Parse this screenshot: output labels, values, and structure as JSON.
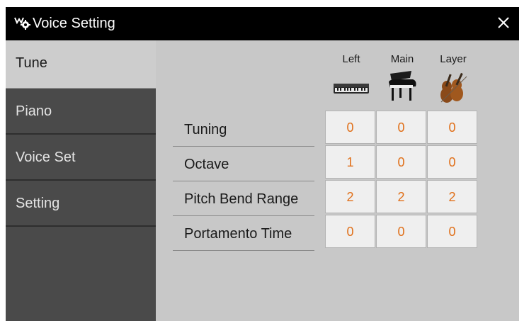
{
  "window": {
    "title": "Voice Setting",
    "title_icon": "keyboard-gear-icon",
    "close_icon": "close-icon"
  },
  "sidebar": {
    "items": [
      {
        "label": "Tune",
        "active": true
      },
      {
        "label": "Piano",
        "active": false
      },
      {
        "label": "Voice Set",
        "active": false
      },
      {
        "label": "Setting",
        "active": false
      }
    ]
  },
  "columns": [
    {
      "label": "Left",
      "icon": "keyboard-icon"
    },
    {
      "label": "Main",
      "icon": "grand-piano-icon"
    },
    {
      "label": "Layer",
      "icon": "strings-icon"
    }
  ],
  "rows": [
    {
      "label": "Tuning",
      "values": [
        "0",
        "0",
        "0"
      ]
    },
    {
      "label": "Octave",
      "values": [
        "1",
        "0",
        "0"
      ]
    },
    {
      "label": "Pitch Bend Range",
      "values": [
        "2",
        "2",
        "2"
      ]
    },
    {
      "label": "Portamento Time",
      "values": [
        "0",
        "0",
        "0"
      ]
    }
  ],
  "colors": {
    "accent_value": "#e0701a",
    "titlebar": "#000000",
    "sidebar": "#4a4a4a",
    "panel": "#c8c8c8"
  }
}
